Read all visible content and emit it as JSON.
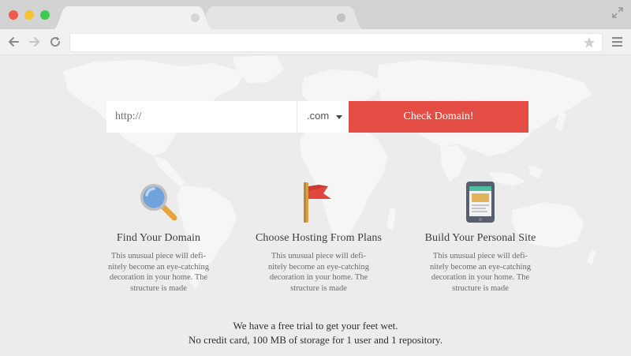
{
  "browser": {
    "address": "",
    "tabs": [
      {
        "state": "active"
      },
      {
        "state": "inactive"
      }
    ]
  },
  "search": {
    "url_placeholder": "http://",
    "tld": ".com",
    "button_label": "Check Domain!"
  },
  "features": [
    {
      "icon": "magnifier-icon",
      "title": "Find Your Domain",
      "description": "This unusual piece will defi-nitely become an eye-catching decoration in your home. The structure is made"
    },
    {
      "icon": "flag-icon",
      "title": "Choose Hosting From Plans",
      "description": "This unusual piece will defi-nitely become an eye-catching decoration in your home. The structure is made"
    },
    {
      "icon": "tablet-icon",
      "title": "Build Your Personal Site",
      "description": "This unusual piece will defi-nitely become an eye-catching decoration in your home. The structure is made"
    }
  ],
  "footer": {
    "line1": "We have a free trial to get your feet wet.",
    "line2": "No credit card, 100 MB of storage for 1 user and 1 repository."
  },
  "colors": {
    "accent": "#e44d43",
    "page_background": "#ececec",
    "map": "#f5f5f5"
  }
}
